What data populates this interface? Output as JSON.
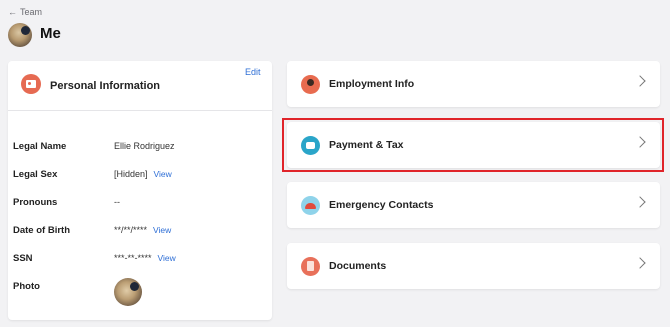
{
  "breadcrumb": {
    "arrow": "←",
    "label": "Team"
  },
  "page": {
    "title": "Me"
  },
  "personal_info": {
    "title": "Personal Information",
    "edit_label": "Edit",
    "rows": [
      {
        "label": "Legal Name",
        "value": "Ellie Rodriguez",
        "link": ""
      },
      {
        "label": "Legal Sex",
        "value": "[Hidden]",
        "link": "View"
      },
      {
        "label": "Pronouns",
        "value": "--",
        "link": ""
      },
      {
        "label": "Date of Birth",
        "value": "**/**/****",
        "link": "View"
      },
      {
        "label": "SSN",
        "value": "***-**-****",
        "link": "View"
      },
      {
        "label": "Photo",
        "value": "",
        "link": ""
      }
    ]
  },
  "sections": [
    {
      "label": "Employment Info",
      "icon": "briefcase-person-icon"
    },
    {
      "label": "Payment & Tax",
      "icon": "piggy-bank-icon"
    },
    {
      "label": "Emergency Contacts",
      "icon": "siren-icon"
    },
    {
      "label": "Documents",
      "icon": "document-icon"
    }
  ],
  "colors": {
    "link": "#2f6fd6",
    "highlight": "#e0242a",
    "accent": "#e66a52"
  }
}
